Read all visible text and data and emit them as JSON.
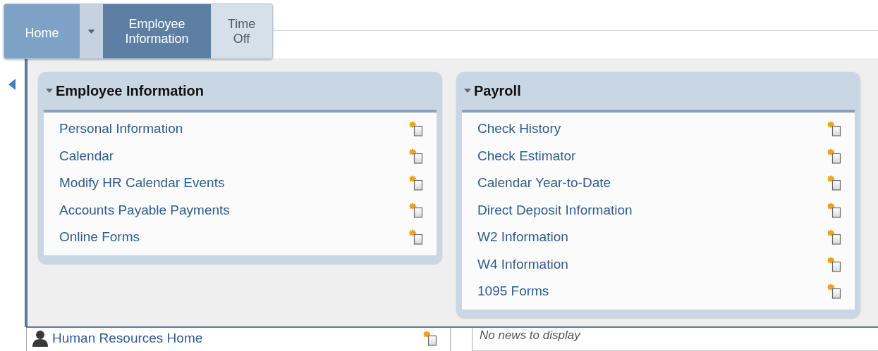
{
  "tabs": [
    {
      "label": "Home",
      "kind": "home",
      "selected": false,
      "has_menu": true
    },
    {
      "label": "Employee Information",
      "kind": "menu",
      "selected": true,
      "has_menu": false
    },
    {
      "label": "Time Off",
      "kind": "menu",
      "selected": false,
      "has_menu": false
    }
  ],
  "dropdown": {
    "panels": [
      {
        "title": "Employee Information",
        "expanded": true,
        "links": [
          "Personal Information",
          "Calendar",
          "Modify HR Calendar Events",
          "Accounts Payable Payments",
          "Online Forms"
        ]
      },
      {
        "title": "Payroll",
        "expanded": true,
        "links": [
          "Check History",
          "Check Estimator",
          "Calendar Year-to-Date",
          "Direct Deposit Information",
          "W2 Information",
          "W4 Information",
          "1095 Forms"
        ]
      }
    ]
  },
  "sidebar": {
    "items": [
      {
        "label": "Human Resources Home"
      }
    ]
  },
  "news": {
    "empty_message": "No news to display"
  }
}
